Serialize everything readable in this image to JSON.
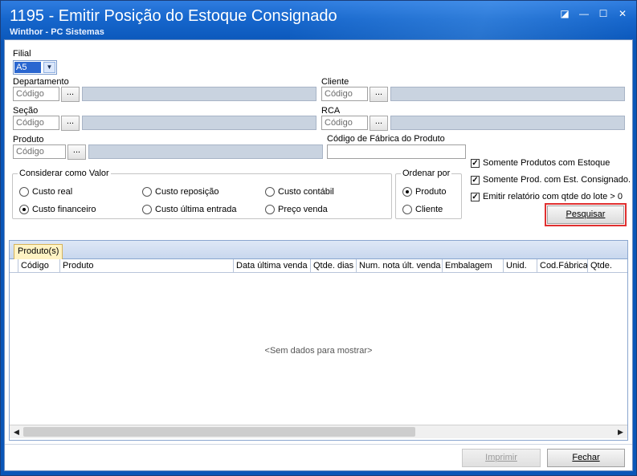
{
  "window": {
    "title": "1195 - Emitir Posição do Estoque Consignado",
    "subtitle": "Winthor - PC Sistemas",
    "buttons": {
      "restore": "◪",
      "minimize": "—",
      "maximize": "☐",
      "close": "✕"
    }
  },
  "filial": {
    "label": "Filial",
    "value": "A5"
  },
  "departamento": {
    "label": "Departamento",
    "placeholder": "Código",
    "button": "..."
  },
  "cliente": {
    "label": "Cliente",
    "placeholder": "Código",
    "button": "..."
  },
  "secao": {
    "label": "Seção",
    "placeholder": "Código",
    "button": "..."
  },
  "rca": {
    "label": "RCA",
    "placeholder": "Código",
    "button": "..."
  },
  "produto": {
    "label": "Produto",
    "placeholder": "Código",
    "button": "..."
  },
  "codigo_fabrica": {
    "label": "Código de Fábrica do Produto",
    "value": ""
  },
  "considerar": {
    "title": "Considerar como Valor",
    "options": [
      "Custo real",
      "Custo reposição",
      "Custo contábil",
      "Custo financeiro",
      "Custo última entrada",
      "Preço venda"
    ],
    "selected": "Custo financeiro"
  },
  "ordenar": {
    "title": "Ordenar por",
    "options": [
      "Produto",
      "Cliente"
    ],
    "selected": "Produto"
  },
  "checks": [
    {
      "label": "Somente Produtos com Estoque",
      "checked": true
    },
    {
      "label": "Somente Prod. com Est. Consignado.",
      "checked": true
    },
    {
      "label": "Emitir relatório com qtde do lote > 0",
      "checked": true
    }
  ],
  "pesquisar": "Pesquisar",
  "grid": {
    "tab": "Produto(s)",
    "columns": [
      "Código",
      "Produto",
      "Data última venda",
      "Qtde. dias",
      "Num. nota últ. venda",
      "Embalagem",
      "Unid.",
      "Cod.Fábrica",
      "Qtde."
    ],
    "empty_text": "<Sem dados para mostrar>"
  },
  "footer": {
    "imprimir": "Imprimir",
    "fechar": "Fechar"
  },
  "colors": {
    "title_bar": "#1666cc",
    "highlight": "#e03030",
    "tab": "#fff3c4"
  }
}
